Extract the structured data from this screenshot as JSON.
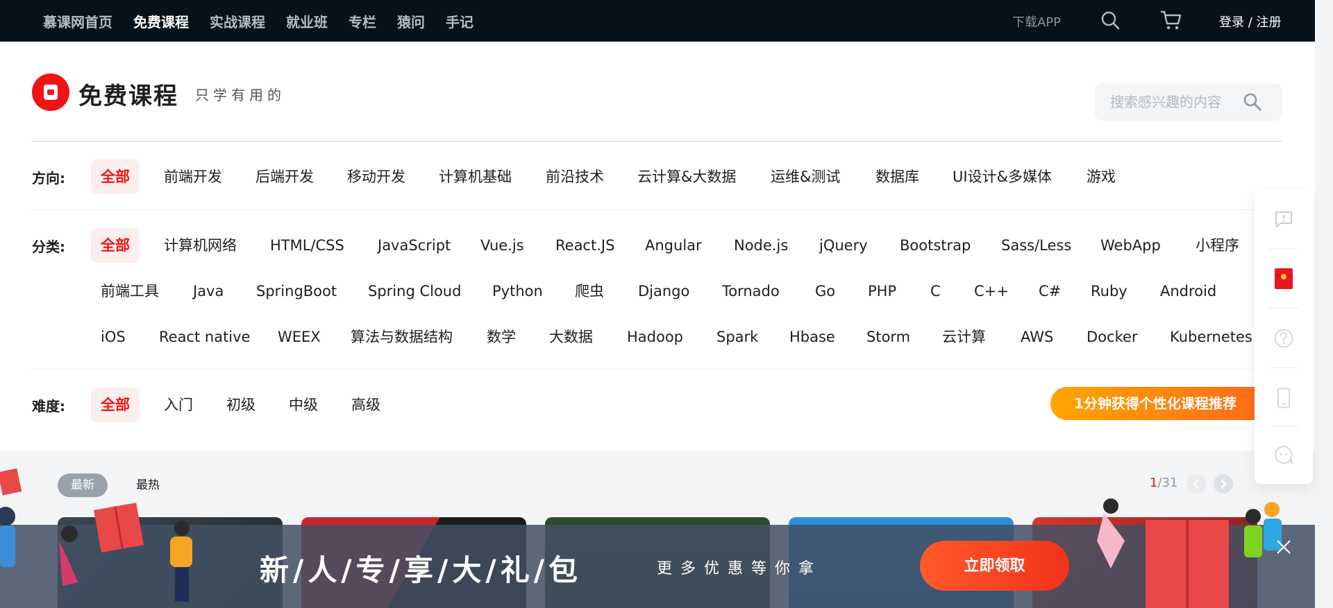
{
  "nav": {
    "items": [
      {
        "label": "慕课网首页",
        "active": false
      },
      {
        "label": "免费课程",
        "active": true
      },
      {
        "label": "实战课程",
        "active": false
      },
      {
        "label": "就业班",
        "active": false
      },
      {
        "label": "专栏",
        "active": false
      },
      {
        "label": "猿问",
        "active": false
      },
      {
        "label": "手记",
        "active": false
      }
    ],
    "download_app": "下载APP",
    "login": "登录 / 注册",
    "icons": [
      "search-icon",
      "cart-icon"
    ]
  },
  "header": {
    "title": "免费课程",
    "slogan": "只学有用的",
    "search_placeholder": "搜索感兴趣的内容"
  },
  "filters": {
    "direction": {
      "label": "方向:",
      "options": [
        "全部",
        "前端开发",
        "后端开发",
        "移动开发",
        "计算机基础",
        "前沿技术",
        "云计算&大数据",
        "运维&测试",
        "数据库",
        "UI设计&多媒体",
        "游戏"
      ],
      "selected": "全部"
    },
    "category": {
      "label": "分类:",
      "rows": [
        [
          "全部",
          "计算机网络",
          "HTML/CSS",
          "JavaScript",
          "Vue.js",
          "React.JS",
          "Angular",
          "Node.js",
          "jQuery",
          "Bootstrap",
          "Sass/Less",
          "WebApp",
          "小程序"
        ],
        [
          "前端工具",
          "Java",
          "SpringBoot",
          "Spring Cloud",
          "Python",
          "爬虫",
          "Django",
          "Tornado",
          "Go",
          "PHP",
          "C",
          "C++",
          "C#",
          "Ruby",
          "Android"
        ],
        [
          "iOS",
          "React native",
          "WEEX",
          "算法与数据结构",
          "数学",
          "大数据",
          "Hadoop",
          "Spark",
          "Hbase",
          "Storm",
          "云计算",
          "AWS",
          "Docker",
          "Kubernetes"
        ]
      ],
      "selected": "全部"
    },
    "difficulty": {
      "label": "难度:",
      "options": [
        "全部",
        "入门",
        "初级",
        "中级",
        "高级"
      ],
      "selected": "全部"
    },
    "promo_button": "1分钟获得个性化课程推荐"
  },
  "sidebar": {
    "icons": [
      "feedback-icon",
      "red-packet-icon",
      "help-icon",
      "mobile-icon",
      "chat-icon"
    ]
  },
  "list": {
    "tabs": [
      "最新",
      "最热"
    ],
    "active_tab": "最新",
    "page_current": "1",
    "page_total": "/31"
  },
  "courses": [
    {
      "colors": [
        "#3d4650",
        "#232a31"
      ]
    },
    {
      "colors": [
        "#c8262e",
        "#1b1b1b"
      ]
    },
    {
      "colors": [
        "#1f3b1f",
        "#2f4d2f"
      ]
    },
    {
      "colors": [
        "#2f8fd8",
        "#1f6fb8"
      ]
    },
    {
      "colors": [
        "#d8372f",
        "#7a1a1a"
      ]
    }
  ],
  "banner": {
    "title": "新/人/专/享/大/礼/包",
    "subtitle": "更多优惠等你拿",
    "button": "立即领取"
  },
  "colors": {
    "accent": "#f01414",
    "nav_bg": "#07111b",
    "promo_orange": "#ff8a00"
  }
}
